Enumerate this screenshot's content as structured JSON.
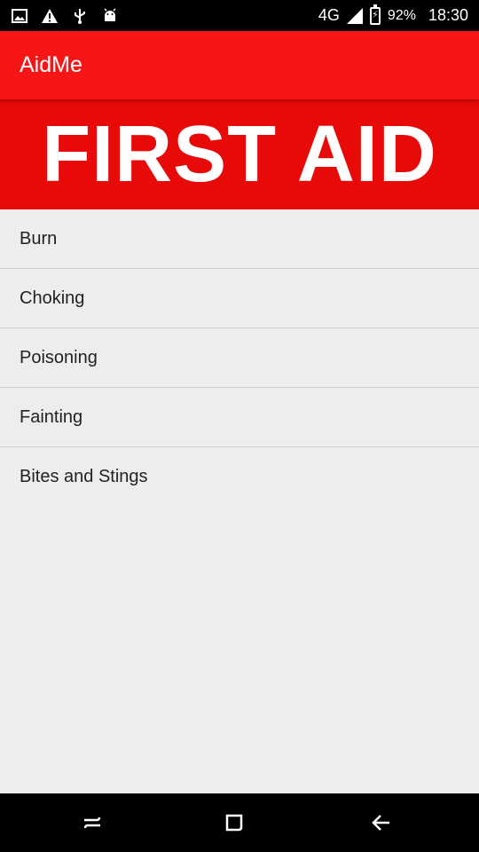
{
  "status_bar": {
    "network": "4G",
    "battery_percent": "92%",
    "time": "18:30",
    "icons": [
      "image-icon",
      "warning-icon",
      "usb-icon",
      "android-debug-icon",
      "signal-icon",
      "battery-icon"
    ]
  },
  "app_bar": {
    "title": "AidMe"
  },
  "banner": {
    "text": "FIRST AID"
  },
  "list": {
    "items": [
      {
        "label": "Burn"
      },
      {
        "label": "Choking"
      },
      {
        "label": "Poisoning"
      },
      {
        "label": "Fainting"
      },
      {
        "label": "Bites and Stings"
      }
    ]
  },
  "colors": {
    "app_bar": "#f81515",
    "banner": "#e80909",
    "background": "#ededed"
  }
}
